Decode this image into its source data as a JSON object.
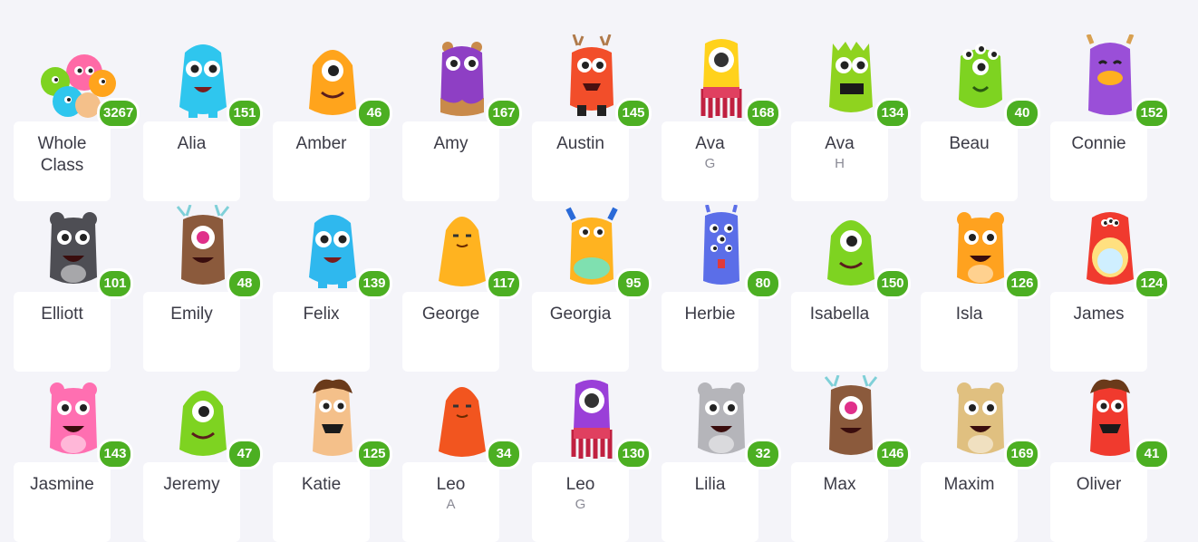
{
  "students": [
    {
      "name": "Whole Class",
      "line1": "Whole",
      "line2": "Class",
      "points": "3267",
      "color": "#ff6aa6",
      "type": "group"
    },
    {
      "name": "Alia",
      "points": "151",
      "color": "#2fc6ee",
      "type": "fluffy"
    },
    {
      "name": "Amber",
      "points": "46",
      "color": "#ffa41c",
      "type": "cyclops"
    },
    {
      "name": "Amy",
      "points": "167",
      "color": "#8e3fc4",
      "type": "drip"
    },
    {
      "name": "Austin",
      "points": "145",
      "color": "#f24e2a",
      "type": "antler"
    },
    {
      "name": "Ava",
      "sub": "G",
      "points": "168",
      "color": "#ffd21c",
      "type": "tentacle"
    },
    {
      "name": "Ava",
      "sub": "H",
      "points": "134",
      "color": "#8fd31f",
      "type": "spiky"
    },
    {
      "name": "Beau",
      "points": "40",
      "color": "#7ed321",
      "type": "threeeye"
    },
    {
      "name": "Connie",
      "points": "152",
      "color": "#9a4fd8",
      "type": "beak"
    },
    {
      "name": "Elliott",
      "points": "101",
      "color": "#4e4e54",
      "type": "bear"
    },
    {
      "name": "Emily",
      "points": "48",
      "color": "#8b5a3c",
      "type": "cyclopsantler"
    },
    {
      "name": "Felix",
      "points": "139",
      "color": "#2fb8ee",
      "type": "fluffy"
    },
    {
      "name": "George",
      "points": "117",
      "color": "#ffb320",
      "type": "blob"
    },
    {
      "name": "Georgia",
      "points": "95",
      "color": "#ffb320",
      "type": "horns"
    },
    {
      "name": "Herbie",
      "points": "80",
      "color": "#5b6ee8",
      "type": "manyeye"
    },
    {
      "name": "Isabella",
      "points": "150",
      "color": "#7ed321",
      "type": "cyclops"
    },
    {
      "name": "Isla",
      "points": "126",
      "color": "#ffa21f",
      "type": "bear"
    },
    {
      "name": "James",
      "points": "124",
      "color": "#f03a2e",
      "type": "belly"
    },
    {
      "name": "Jasmine",
      "points": "143",
      "color": "#ff6fb1",
      "type": "bear"
    },
    {
      "name": "Jeremy",
      "points": "47",
      "color": "#7ed321",
      "type": "cyclops"
    },
    {
      "name": "Katie",
      "points": "125",
      "color": "#f4c08a",
      "type": "hair"
    },
    {
      "name": "Leo",
      "sub": "A",
      "points": "34",
      "color": "#f2551f",
      "type": "blob"
    },
    {
      "name": "Leo",
      "sub": "G",
      "points": "130",
      "color": "#9a3fd8",
      "type": "tentacle"
    },
    {
      "name": "Lilia",
      "points": "32",
      "color": "#b5b5ba",
      "type": "bear"
    },
    {
      "name": "Max",
      "points": "146",
      "color": "#8b5a3c",
      "type": "cyclopsantler"
    },
    {
      "name": "Maxim",
      "points": "169",
      "color": "#e0c080",
      "type": "bear"
    },
    {
      "name": "Oliver",
      "points": "41",
      "color": "#f03a2e",
      "type": "hair"
    }
  ],
  "colors": {
    "badge": "#4caf22",
    "card": "#ffffff",
    "background": "#f4f4f9",
    "text": "#3b3b46",
    "subtext": "#8a8a95"
  }
}
